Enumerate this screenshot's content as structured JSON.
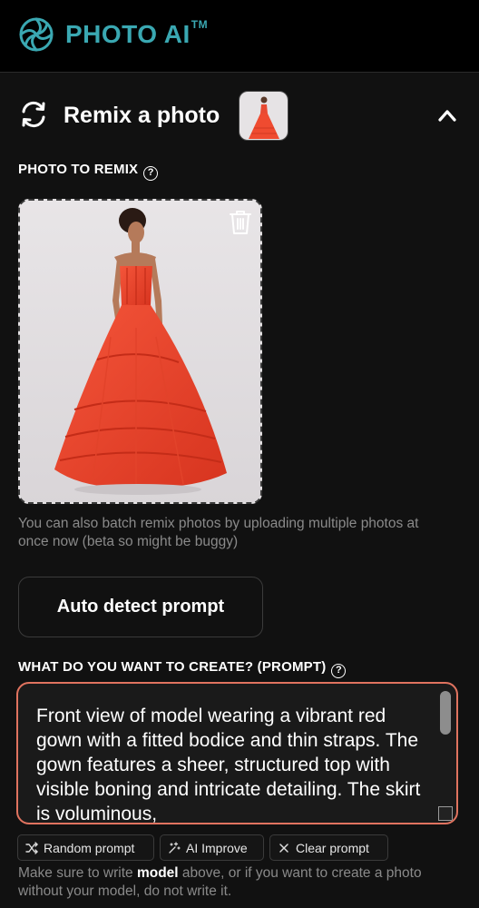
{
  "header": {
    "logo_icon": "spiral-aperture-icon",
    "brand": "PHOTO AI",
    "trademark": "TM",
    "brand_color": "#3aa8b2"
  },
  "remix": {
    "icon": "refresh-arrows-icon",
    "title": "Remix a photo",
    "collapse_icon": "chevron-up-icon"
  },
  "photo_section": {
    "label": "PHOTO TO REMIX",
    "help_icon": "question-circle-icon",
    "delete_icon": "trash-icon",
    "hint": "You can also batch remix photos by uploading multiple photos at once now (beta so might be buggy)"
  },
  "auto_detect_button": "Auto detect prompt",
  "prompt_section": {
    "label": "WHAT DO YOU WANT TO CREATE? (PROMPT)",
    "help_icon": "question-circle-icon",
    "value": "Front view of model wearing a vibrant red gown with a fitted bodice and thin straps. The gown features a sheer, structured top with visible boning and intricate detailing. The skirt is voluminous,",
    "border_color": "#e0735f"
  },
  "prompt_actions": {
    "random": {
      "label": "Random prompt",
      "icon": "shuffle-icon"
    },
    "improve": {
      "label": "AI Improve",
      "icon": "sparkle-icon"
    },
    "clear": {
      "label": "Clear prompt",
      "icon": "x-icon"
    }
  },
  "note": {
    "before": "Make sure to write ",
    "bold": "model",
    "after": " above, or if you want to create a photo without your model, do not write it."
  }
}
